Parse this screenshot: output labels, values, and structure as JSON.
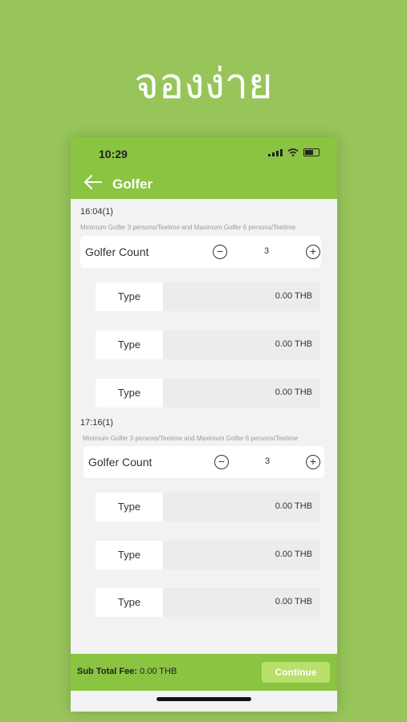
{
  "headline": "จองง่าย",
  "status": {
    "time": "10:29"
  },
  "nav": {
    "title": "Golfer"
  },
  "slots": [
    {
      "time": "16:04(1)",
      "note": "Minimum Golfer 3 persons/Teetime and Maximum Golfer 6 persons/Teetime",
      "count_label": "Golfer Count",
      "count": "3",
      "types": [
        {
          "label": "Type",
          "price": "0.00 THB"
        },
        {
          "label": "Type",
          "price": "0.00 THB"
        },
        {
          "label": "Type",
          "price": "0.00 THB"
        }
      ]
    },
    {
      "time": "17:16(1)",
      "note": "Minimum Golfer 3 persons/Teetime and Maximum Golfer 6 persons/Teetime",
      "count_label": "Golfer Count",
      "count": "3",
      "types": [
        {
          "label": "Type",
          "price": "0.00 THB"
        },
        {
          "label": "Type",
          "price": "0.00 THB"
        },
        {
          "label": "Type",
          "price": "0.00 THB"
        }
      ]
    }
  ],
  "footer": {
    "subtotal_label": "Sub Total Fee:",
    "subtotal_value": "0.00 THB",
    "continue_label": "Continue"
  },
  "colors": {
    "background": "#97c55a",
    "bar": "#8ac441",
    "continue": "#b8e06a"
  }
}
